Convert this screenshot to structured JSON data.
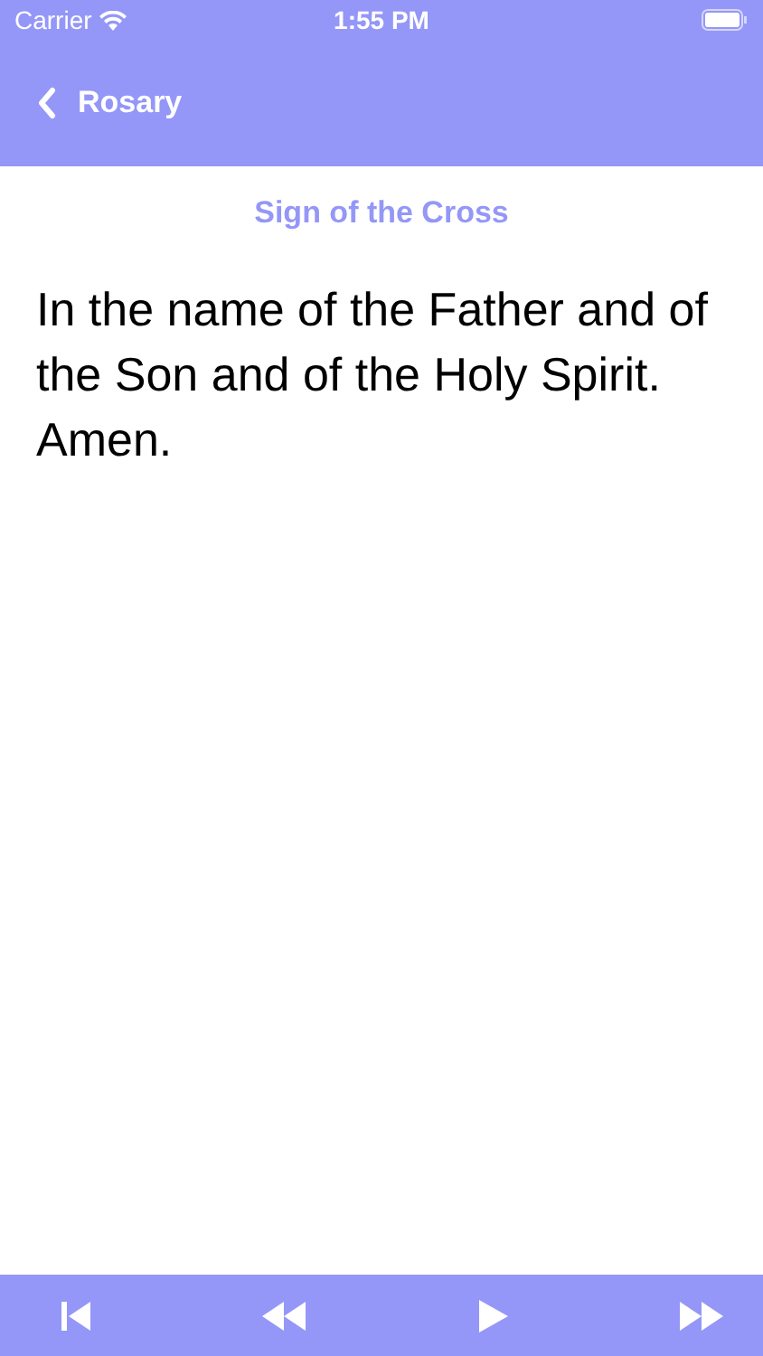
{
  "status_bar": {
    "carrier": "Carrier",
    "time": "1:55 PM"
  },
  "nav_bar": {
    "back_label": "Rosary"
  },
  "prayer": {
    "title": "Sign of the Cross",
    "text": "In the name of the Father and of the Son and of the Holy Spirit. Amen."
  },
  "toolbar": {
    "buttons": [
      {
        "kind": "skip-start"
      },
      {
        "kind": "rewind"
      },
      {
        "kind": "play"
      },
      {
        "kind": "fast-forward"
      }
    ]
  }
}
